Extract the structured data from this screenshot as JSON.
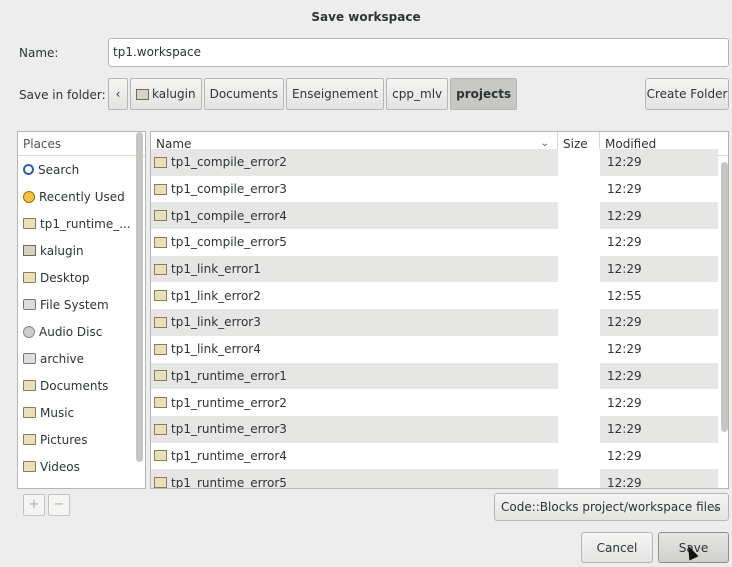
{
  "window": {
    "title": "Save workspace"
  },
  "name_field": {
    "label": "Name:",
    "value": "tp1.workspace"
  },
  "save_in": {
    "label": "Save in folder:",
    "path": [
      "kalugin",
      "Documents",
      "Enseignement",
      "cpp_mlv",
      "projects"
    ],
    "active": "projects",
    "create_folder_label": "Create Folder"
  },
  "places": {
    "header": "Places",
    "items": [
      {
        "label": "Search",
        "icon": "search-icon"
      },
      {
        "label": "Recently Used",
        "icon": "recent-icon"
      },
      {
        "label": "tp1_runtime_...",
        "icon": "folder-icon"
      },
      {
        "label": "kalugin",
        "icon": "home-icon"
      },
      {
        "label": "Desktop",
        "icon": "folder-icon"
      },
      {
        "label": "File System",
        "icon": "drive-icon"
      },
      {
        "label": "Audio Disc",
        "icon": "disc-icon"
      },
      {
        "label": "archive",
        "icon": "drive-icon"
      },
      {
        "label": "Documents",
        "icon": "folder-icon"
      },
      {
        "label": "Music",
        "icon": "folder-icon"
      },
      {
        "label": "Pictures",
        "icon": "folder-icon"
      },
      {
        "label": "Videos",
        "icon": "folder-icon"
      }
    ],
    "add_label": "+",
    "remove_label": "−"
  },
  "files": {
    "columns": {
      "name": "Name",
      "size": "Size",
      "modified": "Modified"
    },
    "rows": [
      {
        "name": "tp1_compile_error2",
        "size": "",
        "modified": "12:29"
      },
      {
        "name": "tp1_compile_error3",
        "size": "",
        "modified": "12:29"
      },
      {
        "name": "tp1_compile_error4",
        "size": "",
        "modified": "12:29"
      },
      {
        "name": "tp1_compile_error5",
        "size": "",
        "modified": "12:29"
      },
      {
        "name": "tp1_link_error1",
        "size": "",
        "modified": "12:29"
      },
      {
        "name": "tp1_link_error2",
        "size": "",
        "modified": "12:55"
      },
      {
        "name": "tp1_link_error3",
        "size": "",
        "modified": "12:29"
      },
      {
        "name": "tp1_link_error4",
        "size": "",
        "modified": "12:29"
      },
      {
        "name": "tp1_runtime_error1",
        "size": "",
        "modified": "12:29"
      },
      {
        "name": "tp1_runtime_error2",
        "size": "",
        "modified": "12:29"
      },
      {
        "name": "tp1_runtime_error3",
        "size": "",
        "modified": "12:29"
      },
      {
        "name": "tp1_runtime_error4",
        "size": "",
        "modified": "12:29"
      },
      {
        "name": "tp1_runtime_error5",
        "size": "",
        "modified": "12:29"
      }
    ]
  },
  "filter": {
    "value": "Code::Blocks project/workspace files"
  },
  "buttons": {
    "cancel": "Cancel",
    "save": "Save"
  }
}
